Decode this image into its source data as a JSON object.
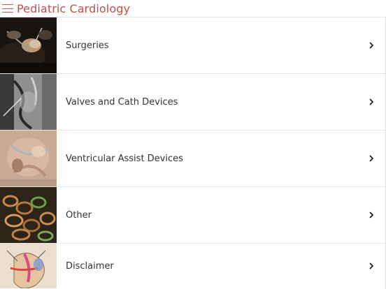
{
  "header": {
    "title": "Pediatric Cardiology",
    "menu_icon": "hamburger-icon",
    "title_color": "#c0504d"
  },
  "list": {
    "items": [
      {
        "label": "Surgeries",
        "thumb": "surgery-photo"
      },
      {
        "label": "Valves and Cath Devices",
        "thumb": "angiogram-photo"
      },
      {
        "label": "Ventricular Assist Devices",
        "thumb": "heart-tissue-photo"
      },
      {
        "label": "Other",
        "thumb": "coiled-wires-photo"
      },
      {
        "label": "Disclaimer",
        "thumb": "heart-diagram-drawing"
      }
    ],
    "chevron_icon": "chevron-right-icon"
  }
}
